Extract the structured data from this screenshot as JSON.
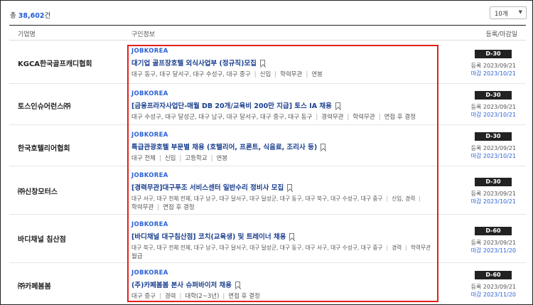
{
  "summary": {
    "prefix": "총 ",
    "count": "38,602",
    "suffix": "건"
  },
  "page_size": {
    "selected": "10개"
  },
  "headers": {
    "company": "기업명",
    "info": "구인정보",
    "dates": "등록/마감일"
  },
  "rows": [
    {
      "company": "KGCA한국골프캐디협회",
      "brand": "JOBKOREA",
      "title": "대기업 골프장호텔 외식사업부 (정규직)모집",
      "meta": [
        "대구 동구, 대구 달서구, 대구 수성구, 대구 중구",
        "신입",
        "학력무관",
        "연봉"
      ],
      "dday": "D-30",
      "registered": "등록 2023/09/21",
      "deadline": "마감 2023/10/21"
    },
    {
      "company": "토스인슈어런스㈜",
      "brand": "JOBKOREA",
      "title": "[금융프라자사업단-매월 DB 20개/교육비 200만 지급] 토스 IA 채용",
      "meta": [
        "대구 수성구, 대구 달성군, 대구 남구, 대구 달서구, 대구 중구, 대구 동구",
        "경력무관",
        "학력무관",
        "면접 후 결정"
      ],
      "dday": "D-30",
      "registered": "등록 2023/09/21",
      "deadline": "마감 2023/10/21"
    },
    {
      "company": "한국호텔리어협회",
      "brand": "JOBKOREA",
      "title": "특급관광호텔 부문별 채용 (호텔리어, 프론트, 식음료, 조리사 등)",
      "meta": [
        "대구 전체",
        "신입",
        "고등학교",
        "연봉"
      ],
      "dday": "D-30",
      "registered": "등록 2023/09/21",
      "deadline": "마감 2023/10/21"
    },
    {
      "company": "㈜신창모터스",
      "brand": "JOBKOREA",
      "title": "[경력무관]대구푸조 서비스센터 일반수리 정비사 모집",
      "meta_line1": [
        "대구 서구, 대구 전체 전체, 대구 남구, 대구 달서구, 대구 달성군, 대구 동구, 대구 북구, 대구 수성구, 대구 중구",
        "신입, 경력"
      ],
      "meta_line2": [
        "학력무관",
        "면접 후 결정"
      ],
      "dday": "D-30",
      "registered": "등록 2023/09/21",
      "deadline": "마감 2023/10/21"
    },
    {
      "company": "바디채널 침산점",
      "brand": "JOBKOREA",
      "title": "[바디채널 대구침산점] 코치(교육생) 및 트레이너 채용",
      "meta_line1": [
        "대구 북구, 대구 전체 전체, 대구 남구, 대구 달서구, 대구 달성군, 대구 동구, 대구 서구, 대구 수성구, 대구 중구",
        "경력",
        "학력무관"
      ],
      "meta_line2": [
        "월급"
      ],
      "dday": "D-60",
      "registered": "등록 2023/09/21",
      "deadline": "마감 2023/11/20"
    },
    {
      "company": "㈜카페봄봄",
      "brand": "JOBKOREA",
      "title": "(주)카페봄봄 본사 슈퍼바이저 채용",
      "meta": [
        "대구 중구",
        "경력",
        "대학(2~3년)",
        "면접 후 결정"
      ],
      "dday": "D-60",
      "registered": "등록 2023/09/21",
      "deadline": "마감 2023/11/20"
    }
  ]
}
